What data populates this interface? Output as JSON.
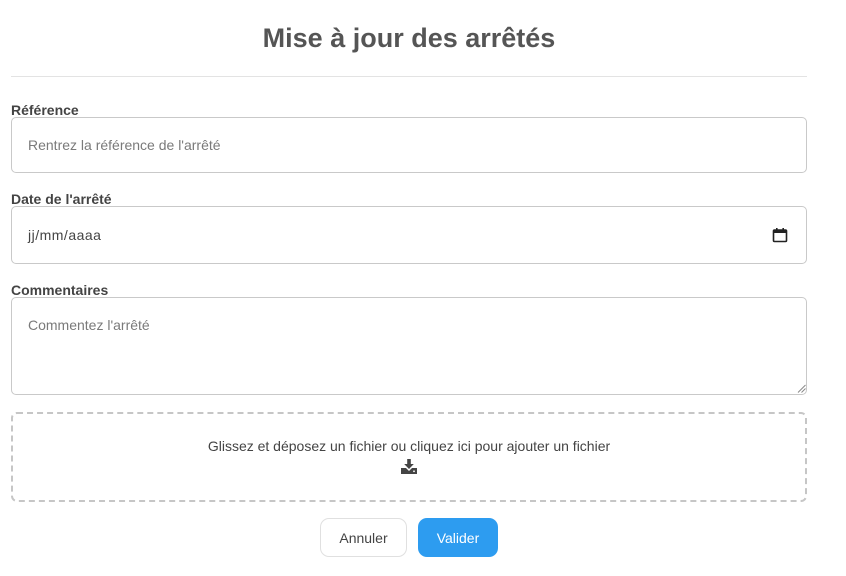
{
  "page": {
    "title": "Mise à jour des arrêtés"
  },
  "form": {
    "reference": {
      "label": "Référence",
      "placeholder": "Rentrez la référence de l'arrêté",
      "value": ""
    },
    "date": {
      "label": "Date de l'arrêté",
      "placeholder": "jj/mm/aaaa",
      "icon": "calendar-icon"
    },
    "comments": {
      "label": "Commentaires",
      "placeholder": "Commentez l'arrêté",
      "value": ""
    },
    "dropzone": {
      "text": "Glissez et déposez un fichier ou cliquez ici pour ajouter un fichier",
      "icon": "download-icon"
    }
  },
  "actions": {
    "cancel_label": "Annuler",
    "submit_label": "Valider"
  },
  "colors": {
    "accent": "#2d9cf0",
    "text": "#444444"
  }
}
